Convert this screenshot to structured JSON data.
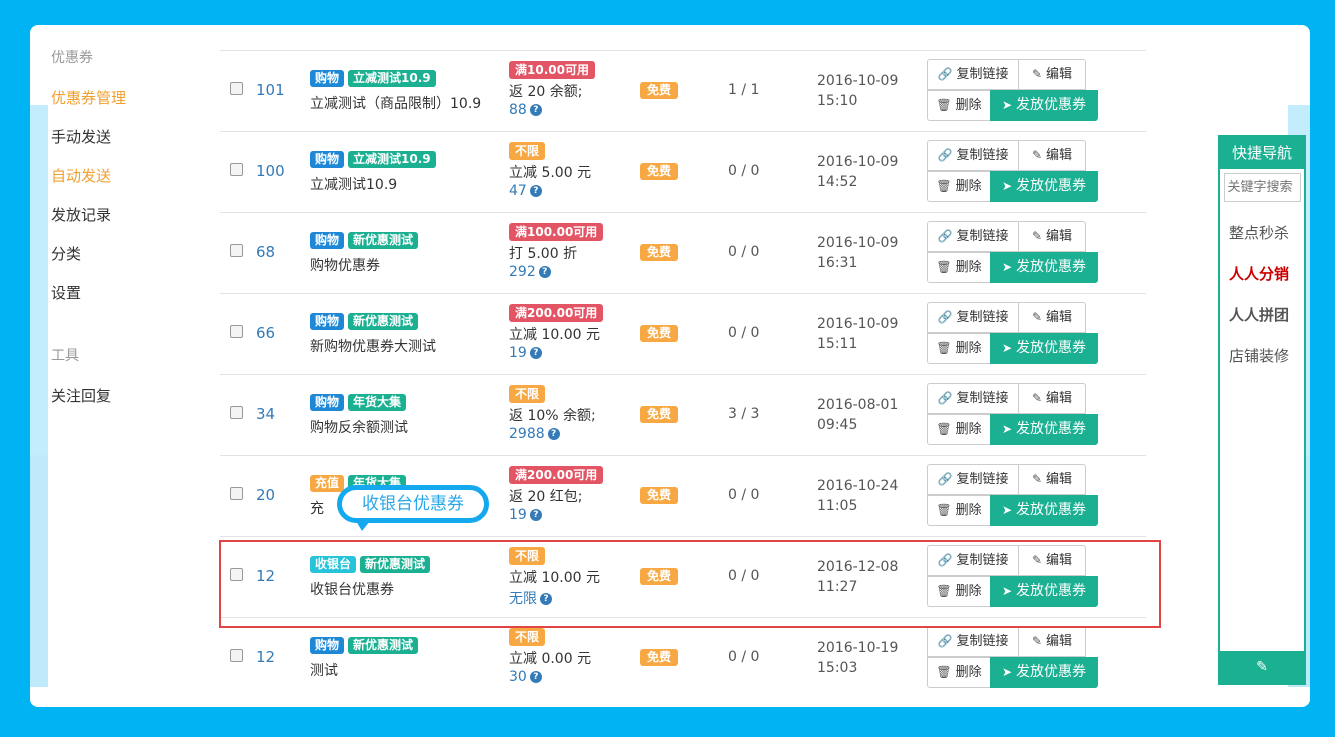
{
  "sidebar": {
    "section1_title": "优惠券",
    "items": [
      {
        "label": "优惠券管理"
      },
      {
        "label": "手动发送"
      },
      {
        "label": "自动发送"
      },
      {
        "label": "发放记录"
      },
      {
        "label": "分类"
      },
      {
        "label": "设置"
      }
    ],
    "section2_title": "工具",
    "tool_items": [
      {
        "label": "关注回复"
      }
    ]
  },
  "buttons": {
    "copy_link": "复制链接",
    "edit": "编辑",
    "delete": "删除",
    "issue": "发放优惠券"
  },
  "coupons": [
    {
      "id": "101",
      "tags": [
        "购物",
        "立减测试10.9"
      ],
      "name": "立减测试（商品限制）10.9",
      "condition": "满10.00可用",
      "benefit": "返 20 余额;",
      "remaining": "88",
      "cost": "免费",
      "count": "1 / 1",
      "date": "2016-10-09",
      "time": "15:10"
    },
    {
      "id": "100",
      "tags": [
        "购物",
        "立减测试10.9"
      ],
      "name": "立减测试10.9",
      "condition": "不限",
      "benefit": "立减 5.00 元",
      "remaining": "47",
      "cost": "免费",
      "count": "0 / 0",
      "date": "2016-10-09",
      "time": "14:52"
    },
    {
      "id": "68",
      "tags": [
        "购物",
        "新优惠测试"
      ],
      "name": "购物优惠券",
      "condition": "满100.00可用",
      "benefit": "打 5.00 折",
      "remaining": "292",
      "cost": "免费",
      "count": "0 / 0",
      "date": "2016-10-09",
      "time": "16:31"
    },
    {
      "id": "66",
      "tags": [
        "购物",
        "新优惠测试"
      ],
      "name": "新购物优惠券大测试",
      "condition": "满200.00可用",
      "benefit": "立减 10.00 元",
      "remaining": "19",
      "cost": "免费",
      "count": "0 / 0",
      "date": "2016-10-09",
      "time": "15:11"
    },
    {
      "id": "34",
      "tags": [
        "购物",
        "年货大集"
      ],
      "name": "购物反余额测试",
      "condition": "不限",
      "benefit": "返 10% 余额;",
      "remaining": "2988",
      "cost": "免费",
      "count": "3 / 3",
      "date": "2016-08-01",
      "time": "09:45"
    },
    {
      "id": "20",
      "tags": [
        "充值",
        "年货大集"
      ],
      "name": "充",
      "condition": "满200.00可用",
      "benefit": "返 20 红包;",
      "remaining": "19",
      "cost": "免费",
      "count": "0 / 0",
      "date": "2016-10-24",
      "time": "11:05"
    },
    {
      "id": "12",
      "tags": [
        "收银台",
        "新优惠测试"
      ],
      "name": "收银台优惠券",
      "condition": "不限",
      "benefit": "立减 10.00 元",
      "remaining": "无限",
      "cost": "免费",
      "count": "0 / 0",
      "date": "2016-12-08",
      "time": "11:27"
    },
    {
      "id": "12",
      "tags": [
        "购物",
        "新优惠测试"
      ],
      "name": "测试",
      "condition": "不限",
      "benefit": "立减 0.00 元",
      "remaining": "30",
      "cost": "免费",
      "count": "0 / 0",
      "date": "2016-10-19",
      "time": "15:03"
    }
  ],
  "callout": "收银台优惠券",
  "quicknav": {
    "title": "快捷导航",
    "search_placeholder": "关键字搜索",
    "items": [
      "整点秒杀",
      "人人分销",
      "人人拼团",
      "店铺装修"
    ]
  },
  "colors": {
    "accent": "#1bb092",
    "frame_bg": "#00b4f4",
    "active_nav": "#f0a030",
    "highlight": "#e04444"
  }
}
